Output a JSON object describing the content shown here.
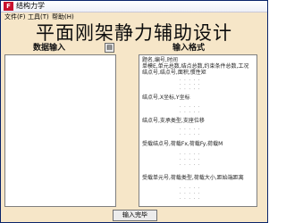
{
  "window": {
    "title": "结构力学"
  },
  "menu": {
    "items": [
      {
        "label": "文件(F)"
      },
      {
        "label": "工具(T)"
      },
      {
        "label": "帮助(H)"
      }
    ]
  },
  "main": {
    "title": "平面刚架静力辅助设计",
    "data_input_header": "数据输入",
    "input_format_header": "输入格式",
    "data_input_value": "",
    "format_lines": [
      "题名,编号,时间",
      "单模E,单元总数,结点总数,约束条件总数,工况",
      "结点号,结点号,面积,惯性矩",
      "结点号,X坐标,Y坐标",
      "结点号,支承类型,支座位移",
      "受载结点号,荷载Fx,荷载Fy,荷载M",
      "受载单元号,荷载类型,荷载大小,距始端距离"
    ],
    "dot_pattern": ". . . . ."
  },
  "footer": {
    "finish_button": "输入完毕"
  }
}
